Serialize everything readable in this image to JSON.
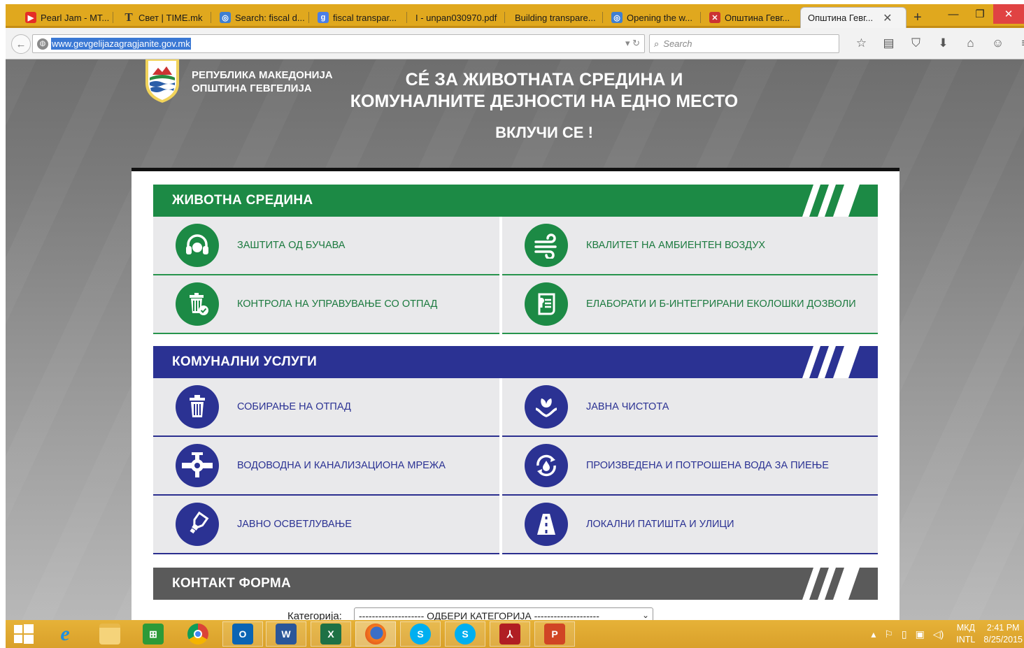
{
  "browser": {
    "tabs": [
      {
        "label": "Pearl Jam - MT...",
        "icon": "youtube-icon",
        "color": "#e52d27"
      },
      {
        "label": "Свет | TIME.mk",
        "icon": "time-mk-icon",
        "color": "#333333"
      },
      {
        "label": "Search: fiscal d...",
        "icon": "un-globe-icon",
        "color": "#3f7fd1"
      },
      {
        "label": "fiscal transpar...",
        "icon": "google-icon",
        "color": "#4a7fe8"
      },
      {
        "label": "I - unpan030970.pdf",
        "icon": "none",
        "color": ""
      },
      {
        "label": "Building transpare...",
        "icon": "none",
        "color": ""
      },
      {
        "label": "Opening the w...",
        "icon": "un-globe-icon",
        "color": "#3f7fd1"
      },
      {
        "label": "Општина Гевг...",
        "icon": "municipality-icon",
        "color": "#cc3333"
      },
      {
        "label": "Општина Гевг...",
        "icon": "none",
        "color": ""
      }
    ],
    "url": "www.gevgelijazagragjanite.gov.mk",
    "search_placeholder": "Search"
  },
  "header": {
    "republic_line1": "РЕПУБЛИКА МАКЕДОНИЈА",
    "republic_line2": "ОПШТИНА ГЕВГЕЛИЈА",
    "slogan_line1": "СÉ ЗА ЖИВОТНАТА СРЕДИНА И",
    "slogan_line2": "КОМУНАЛНИТЕ ДЕЈНОСТИ НА ЕДНО МЕСТО",
    "cta": "ВКЛУЧИ СЕ !"
  },
  "sections": {
    "environment": {
      "title": "ЖИВОТНА СРЕДИНА",
      "color": "#1c8a45",
      "items": [
        {
          "label": "ЗАШТИТА ОД БУЧАВА",
          "icon": "headphones-icon"
        },
        {
          "label": "КВАЛИТЕТ НА АМБИЕНТЕН ВОЗДУХ",
          "icon": "wind-icon"
        },
        {
          "label": "КОНТРОЛА НА УПРАВУВАЊЕ СО ОТПАД",
          "icon": "trash-check-icon"
        },
        {
          "label": "ЕЛАБОРАТИ И Б-ИНТЕГРИРАНИ ЕКОЛОШКИ ДОЗВОЛИ",
          "icon": "document-icon"
        }
      ]
    },
    "communal": {
      "title": "КОМУНАЛНИ УСЛУГИ",
      "color": "#2b3293",
      "items": [
        {
          "label": "СОБИРАЊЕ НА ОТПАД",
          "icon": "trash-icon"
        },
        {
          "label": "ЈАВНА ЧИСТОТА",
          "icon": "plant-hands-icon"
        },
        {
          "label": "ВОДОВОДНА И КАНАЛИЗАЦИОНА МРЕЖА",
          "icon": "pipe-valve-icon"
        },
        {
          "label": "ПРОИЗВЕДЕНА И ПОТРОШЕНА ВОДА ЗА ПИЕЊЕ",
          "icon": "water-cycle-icon"
        },
        {
          "label": "ЈАВНО ОСВЕТЛУВАЊЕ",
          "icon": "lightbulb-icon"
        },
        {
          "label": "ЛОКАЛНИ ПАТИШТА И УЛИЦИ",
          "icon": "road-icon"
        }
      ]
    },
    "contact": {
      "title": "КОНТАКТ ФОРМА",
      "color": "#5a5a5a",
      "category_label": "Категорија:",
      "category_value": "-------------------- ОДБЕРИ КАТЕГОРИЈА --------------------"
    }
  },
  "taskbar": {
    "apps": [
      "internet-explorer-icon",
      "file-explorer-icon",
      "store-icon",
      "chrome-icon",
      "outlook-icon",
      "word-icon",
      "excel-icon",
      "firefox-icon",
      "skype-icon",
      "skype-icon",
      "acrobat-icon",
      "powerpoint-icon"
    ],
    "language": "МКД",
    "keyboard": "INTL",
    "time": "2:41 PM",
    "date": "8/25/2015"
  }
}
